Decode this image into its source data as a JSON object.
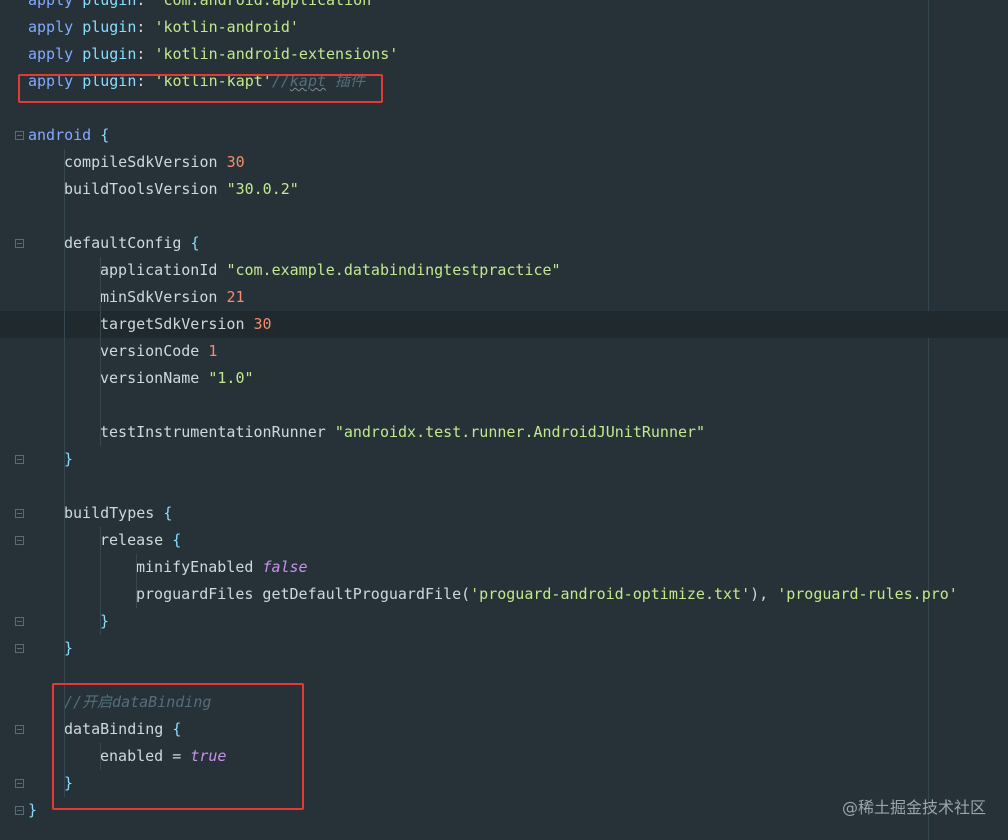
{
  "code_lines": [
    {
      "indent": 0,
      "parts": [
        [
          "kw",
          "apply"
        ],
        [
          "txt",
          " "
        ],
        [
          "fn",
          "plugin"
        ],
        [
          "txt",
          ": "
        ],
        [
          "str",
          "'com.android.application'"
        ]
      ]
    },
    {
      "indent": 0,
      "parts": [
        [
          "kw",
          "apply"
        ],
        [
          "txt",
          " "
        ],
        [
          "fn",
          "plugin"
        ],
        [
          "txt",
          ": "
        ],
        [
          "str",
          "'kotlin-android'"
        ]
      ]
    },
    {
      "indent": 0,
      "parts": [
        [
          "kw",
          "apply"
        ],
        [
          "txt",
          " "
        ],
        [
          "fn",
          "plugin"
        ],
        [
          "txt",
          ": "
        ],
        [
          "str",
          "'kotlin-android-extensions'"
        ]
      ]
    },
    {
      "indent": 0,
      "parts": [
        [
          "kw",
          "apply"
        ],
        [
          "txt",
          " "
        ],
        [
          "fn",
          "plugin"
        ],
        [
          "txt",
          ": "
        ],
        [
          "str",
          "'kotlin-kapt'"
        ],
        [
          "cmt",
          "//"
        ],
        [
          "cmtw",
          "kapt"
        ],
        [
          "cmt",
          " 插件"
        ]
      ]
    },
    {
      "indent": 0,
      "parts": []
    },
    {
      "indent": 0,
      "parts": [
        [
          "kw",
          "android"
        ],
        [
          "txt",
          " "
        ],
        [
          "punc",
          "{"
        ]
      ]
    },
    {
      "indent": 1,
      "parts": [
        [
          "txt",
          "compileSdkVersion "
        ],
        [
          "num",
          "30"
        ]
      ]
    },
    {
      "indent": 1,
      "parts": [
        [
          "txt",
          "buildToolsVersion "
        ],
        [
          "str",
          "\"30.0.2\""
        ]
      ]
    },
    {
      "indent": 0,
      "parts": []
    },
    {
      "indent": 1,
      "parts": [
        [
          "txt",
          "defaultConfig "
        ],
        [
          "punc",
          "{"
        ]
      ]
    },
    {
      "indent": 2,
      "parts": [
        [
          "txt",
          "applicationId "
        ],
        [
          "str",
          "\"com.example.databindingtestpractice\""
        ]
      ]
    },
    {
      "indent": 2,
      "parts": [
        [
          "txt",
          "minSdkVersion "
        ],
        [
          "num",
          "21"
        ]
      ]
    },
    {
      "indent": 2,
      "parts": [
        [
          "txt",
          "targetSdkVersion "
        ],
        [
          "num",
          "30"
        ]
      ]
    },
    {
      "indent": 2,
      "parts": [
        [
          "txt",
          "versionCode "
        ],
        [
          "num",
          "1"
        ]
      ]
    },
    {
      "indent": 2,
      "parts": [
        [
          "txt",
          "versionName "
        ],
        [
          "str",
          "\"1.0\""
        ]
      ]
    },
    {
      "indent": 0,
      "parts": []
    },
    {
      "indent": 2,
      "parts": [
        [
          "txt",
          "testInstrumentationRunner "
        ],
        [
          "str",
          "\"androidx.test.runner.AndroidJUnitRunner\""
        ]
      ]
    },
    {
      "indent": 1,
      "parts": [
        [
          "punc",
          "}"
        ]
      ]
    },
    {
      "indent": 0,
      "parts": []
    },
    {
      "indent": 1,
      "parts": [
        [
          "txt",
          "buildTypes "
        ],
        [
          "punc",
          "{"
        ]
      ]
    },
    {
      "indent": 2,
      "parts": [
        [
          "txt",
          "release "
        ],
        [
          "punc",
          "{"
        ]
      ]
    },
    {
      "indent": 3,
      "parts": [
        [
          "txt",
          "minifyEnabled "
        ],
        [
          "bool",
          "false"
        ]
      ]
    },
    {
      "indent": 3,
      "parts": [
        [
          "txt",
          "proguardFiles getDefaultProguardFile("
        ],
        [
          "str",
          "'proguard-android-optimize.txt'"
        ],
        [
          "txt",
          "), "
        ],
        [
          "str",
          "'proguard-rules.pro'"
        ]
      ]
    },
    {
      "indent": 2,
      "parts": [
        [
          "punc",
          "}"
        ]
      ]
    },
    {
      "indent": 1,
      "parts": [
        [
          "punc",
          "}"
        ]
      ]
    },
    {
      "indent": 0,
      "parts": []
    },
    {
      "indent": 1,
      "parts": [
        [
          "cmt",
          "//开启dataBinding"
        ]
      ]
    },
    {
      "indent": 1,
      "parts": [
        [
          "txt",
          "dataBinding "
        ],
        [
          "punc",
          "{"
        ]
      ]
    },
    {
      "indent": 2,
      "parts": [
        [
          "txt",
          "enabled = "
        ],
        [
          "bool",
          "true"
        ]
      ]
    },
    {
      "indent": 1,
      "parts": [
        [
          "punc",
          "}"
        ]
      ]
    },
    {
      "indent": 0,
      "parts": [
        [
          "punc",
          "}"
        ]
      ]
    }
  ],
  "current_line_index": 12,
  "watermark": "@稀土掘金技术社区",
  "colors": {
    "background": "#263238",
    "keyword": "#82aaff",
    "string": "#c3e88d",
    "number": "#f78c6c",
    "boolean": "#c792ea",
    "comment": "#546e7a",
    "highlight_box": "#e53935"
  }
}
